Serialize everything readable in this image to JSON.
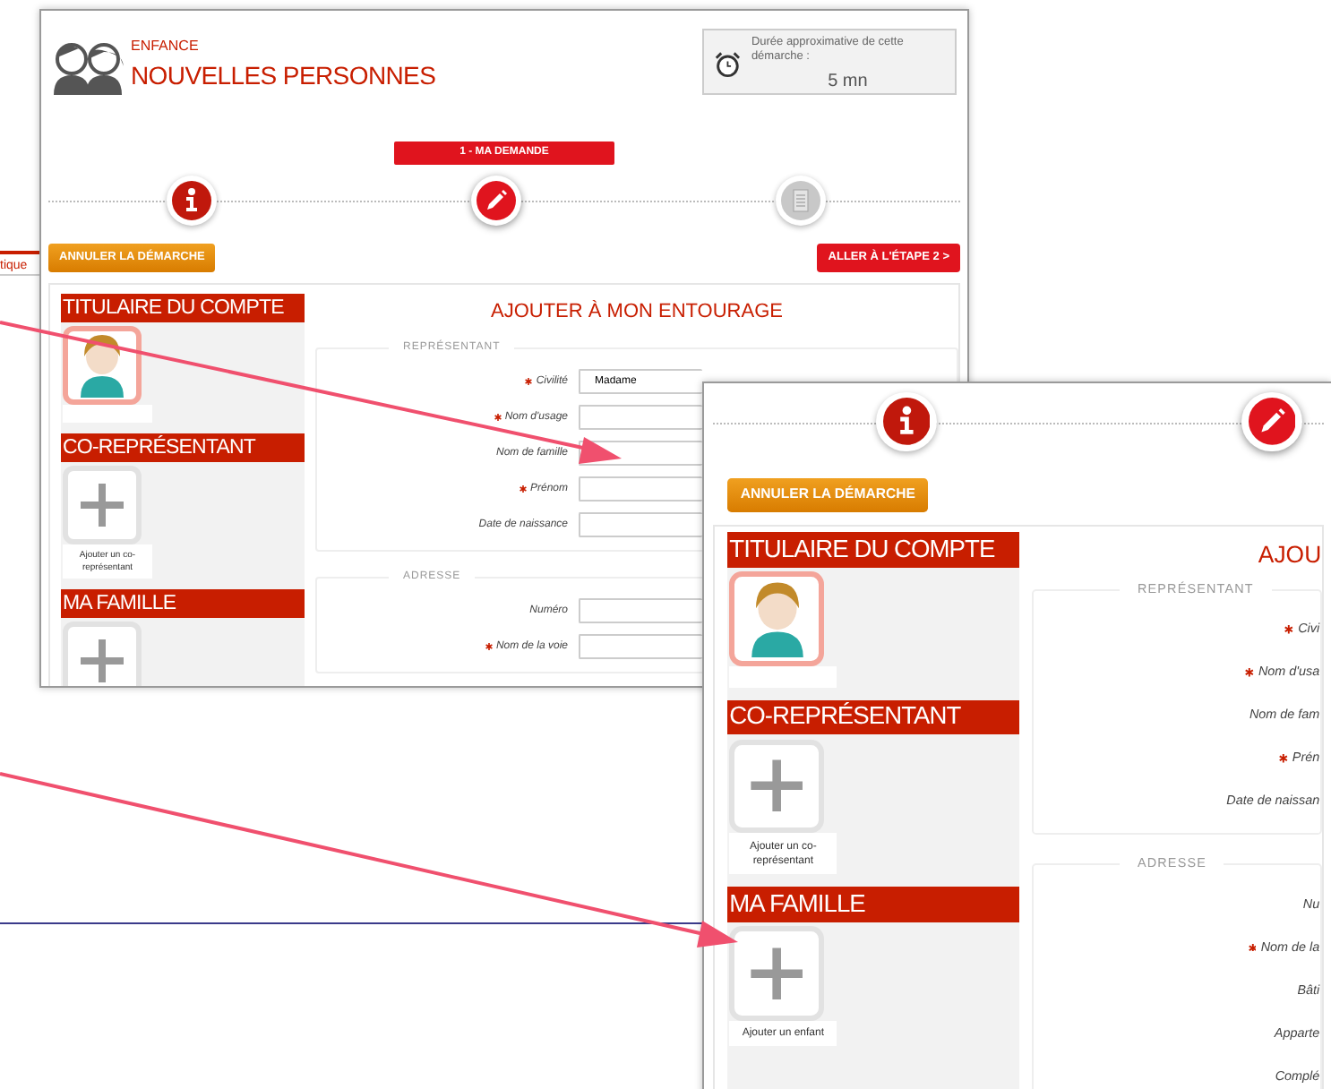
{
  "background": {
    "tab_fragment": "tique"
  },
  "screenshots": [
    {
      "header": {
        "category": "ENFANCE",
        "title": "NOUVELLES PERSONNES",
        "duration": {
          "label": "Durée approximative de cette démarche :",
          "value": "5 mn"
        }
      },
      "step_label": "1 - MA DEMANDE",
      "steps": [
        {
          "kind": "info",
          "done": true,
          "selected": false
        },
        {
          "kind": "edit",
          "done": false,
          "selected": true
        },
        {
          "kind": "document",
          "done": false,
          "selected": false
        }
      ],
      "buttons": [
        {
          "label": "ANNULER LA DÉMARCHE",
          "kind": "cancel"
        },
        {
          "label": "ALLER À L'ÉTAPE 2 >",
          "kind": "next"
        }
      ],
      "sidebar": [
        {
          "title": "TITULAIRE DU COMPTE",
          "kind": "avatar"
        },
        {
          "title": "CO-REPRÉSENTANT",
          "kind": "add",
          "caption": "Ajouter un co-représentant"
        },
        {
          "title": "MA FAMILLE",
          "kind": "add"
        }
      ],
      "form_title": "AJOUTER À MON ENTOURAGE",
      "fieldsets": [
        {
          "legend": "REPRÉSENTANT",
          "fields": [
            {
              "label": "Civilité",
              "required": true,
              "kind": "input",
              "value": "Madame"
            },
            {
              "label": "Nom d'usage",
              "required": true,
              "kind": "input"
            },
            {
              "label": "Nom de famille",
              "required": false,
              "kind": "input"
            },
            {
              "label": "Prénom",
              "required": true,
              "kind": "input"
            },
            {
              "label": "Date de naissance",
              "required": false,
              "kind": "input"
            }
          ]
        },
        {
          "legend": "ADRESSE",
          "fields": [
            {
              "label": "Numéro",
              "required": false,
              "kind": "input"
            },
            {
              "label": "Nom de la voie",
              "required": true,
              "kind": "input"
            }
          ]
        }
      ]
    },
    {
      "steps": [
        {
          "kind": "info",
          "done": true,
          "selected": false
        },
        {
          "kind": "edit",
          "done": false,
          "selected": true
        }
      ],
      "buttons": [
        {
          "label": "ANNULER LA DÉMARCHE",
          "kind": "cancel"
        }
      ],
      "sidebar": [
        {
          "title": "TITULAIRE DU COMPTE",
          "kind": "avatar"
        },
        {
          "title": "CO-REPRÉSENTANT",
          "kind": "add",
          "caption": "Ajouter un co-représentant"
        },
        {
          "title": "MA FAMILLE",
          "kind": "add",
          "caption": "Ajouter un enfant"
        }
      ],
      "form_title": "AJOU",
      "fieldsets": [
        {
          "legend": "REPRÉSENTANT",
          "fields": [
            {
              "label": "Civi",
              "required": true,
              "kind": "label"
            },
            {
              "label": "Nom d'usa",
              "required": true,
              "kind": "label"
            },
            {
              "label": "Nom de fam",
              "required": false,
              "kind": "label"
            },
            {
              "label": "Prén",
              "required": true,
              "kind": "label"
            },
            {
              "label": "Date de naissan",
              "required": false,
              "kind": "label"
            }
          ]
        },
        {
          "legend": "ADRESSE",
          "fields": [
            {
              "label": "Nu",
              "required": false,
              "kind": "label"
            },
            {
              "label": "Nom de la",
              "required": true,
              "kind": "label"
            },
            {
              "label": "Bâti",
              "required": false,
              "kind": "label"
            },
            {
              "label": "Apparte",
              "required": false,
              "kind": "label"
            },
            {
              "label": "Complé",
              "required": false,
              "kind": "label"
            }
          ]
        }
      ]
    }
  ]
}
